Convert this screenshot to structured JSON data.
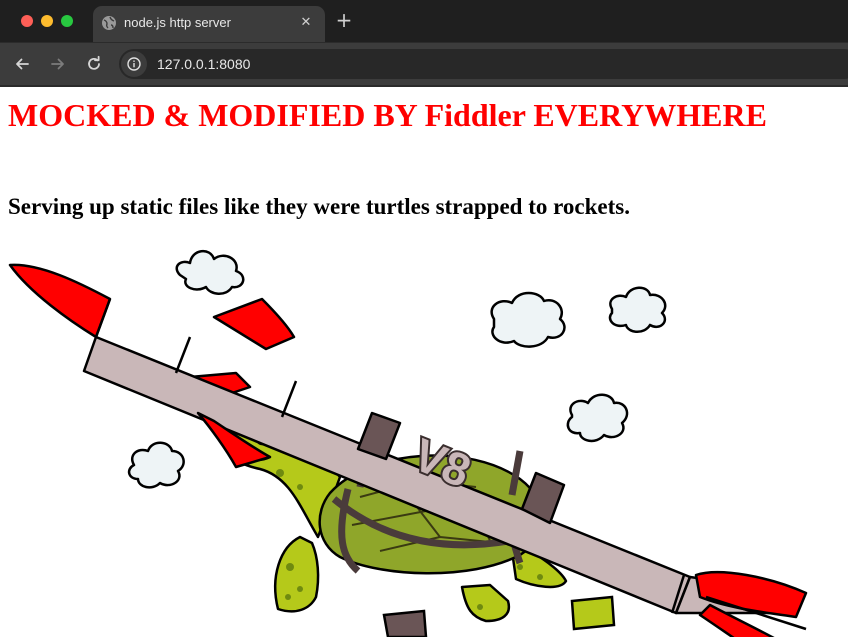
{
  "browser": {
    "tab": {
      "title": "node.js http server",
      "favicon": "globe-icon",
      "close_icon": "close-icon"
    },
    "new_tab_icon": "plus-icon",
    "nav": {
      "back_icon": "arrow-left-icon",
      "forward_icon": "arrow-right-icon",
      "reload_icon": "reload-icon",
      "site_info_icon": "info-icon"
    },
    "address": "127.0.0.1:8080"
  },
  "page": {
    "heading": "MOCKED & MODIFIED BY Fiddler EVERYWHERE",
    "heading_color": "#ff0000",
    "subheading": "Serving up static files like they were turtles strapped to rockets.",
    "logo": {
      "description_icon": "turtle-rocket-logo",
      "rocket_text": "V8"
    }
  },
  "colors": {
    "chrome_dark": "#1f1f1f",
    "chrome_toolbar": "#3c3c3c",
    "rocket_red": "#ff0000",
    "turtle_green": "#b5c91a"
  }
}
